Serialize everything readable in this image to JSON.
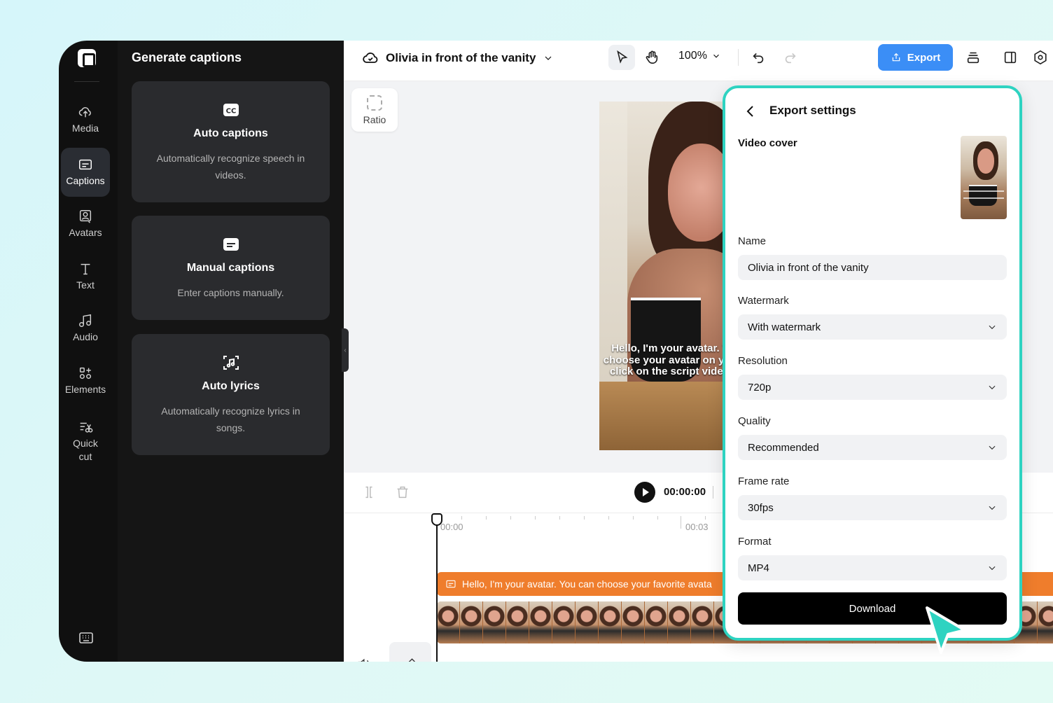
{
  "rail": {
    "items": [
      {
        "label": "Media",
        "icon": "cloud-upload-icon"
      },
      {
        "label": "Captions",
        "icon": "captions-icon"
      },
      {
        "label": "Avatars",
        "icon": "avatar-icon"
      },
      {
        "label": "Text",
        "icon": "text-icon"
      },
      {
        "label": "Audio",
        "icon": "music-note-icon"
      },
      {
        "label": "Elements",
        "icon": "elements-icon"
      },
      {
        "label": "Quick cut",
        "icon": "quick-cut-icon"
      }
    ],
    "active": "Captions"
  },
  "panel": {
    "title": "Generate captions",
    "cards": [
      {
        "title": "Auto captions",
        "desc": "Automatically recognize speech in videos.",
        "icon": "cc-icon"
      },
      {
        "title": "Manual captions",
        "desc": "Enter captions manually.",
        "icon": "subtitle-icon"
      },
      {
        "title": "Auto lyrics",
        "desc": "Automatically recognize lyrics in songs.",
        "icon": "lyrics-icon"
      }
    ]
  },
  "topbar": {
    "project_name": "Olivia in front of the vanity",
    "zoom": "100%",
    "export_label": "Export"
  },
  "canvas": {
    "ratio_label": "Ratio",
    "subtitle_text": "Hello, I'm your avatar. You can choose your avatar on your right, click on the script video to edit"
  },
  "timeline": {
    "timecode": "00:00:00",
    "ruler": [
      "00:00",
      "00:03"
    ],
    "caption_text": "Hello, I'm your avatar. You can choose your favorite avata"
  },
  "export_settings": {
    "title": "Export settings",
    "cover_label": "Video cover",
    "name_label": "Name",
    "name_value": "Olivia in front of the vanity",
    "watermark_label": "Watermark",
    "watermark_value": "With watermark",
    "resolution_label": "Resolution",
    "resolution_value": "720p",
    "quality_label": "Quality",
    "quality_value": "Recommended",
    "framerate_label": "Frame rate",
    "framerate_value": "30fps",
    "format_label": "Format",
    "format_value": "MP4",
    "download_label": "Download"
  },
  "colors": {
    "accent": "#3b8ef6",
    "highlight_border": "#2ed3c1",
    "caption_track": "#ef7d2c",
    "cursor": "#2ed3c1"
  }
}
